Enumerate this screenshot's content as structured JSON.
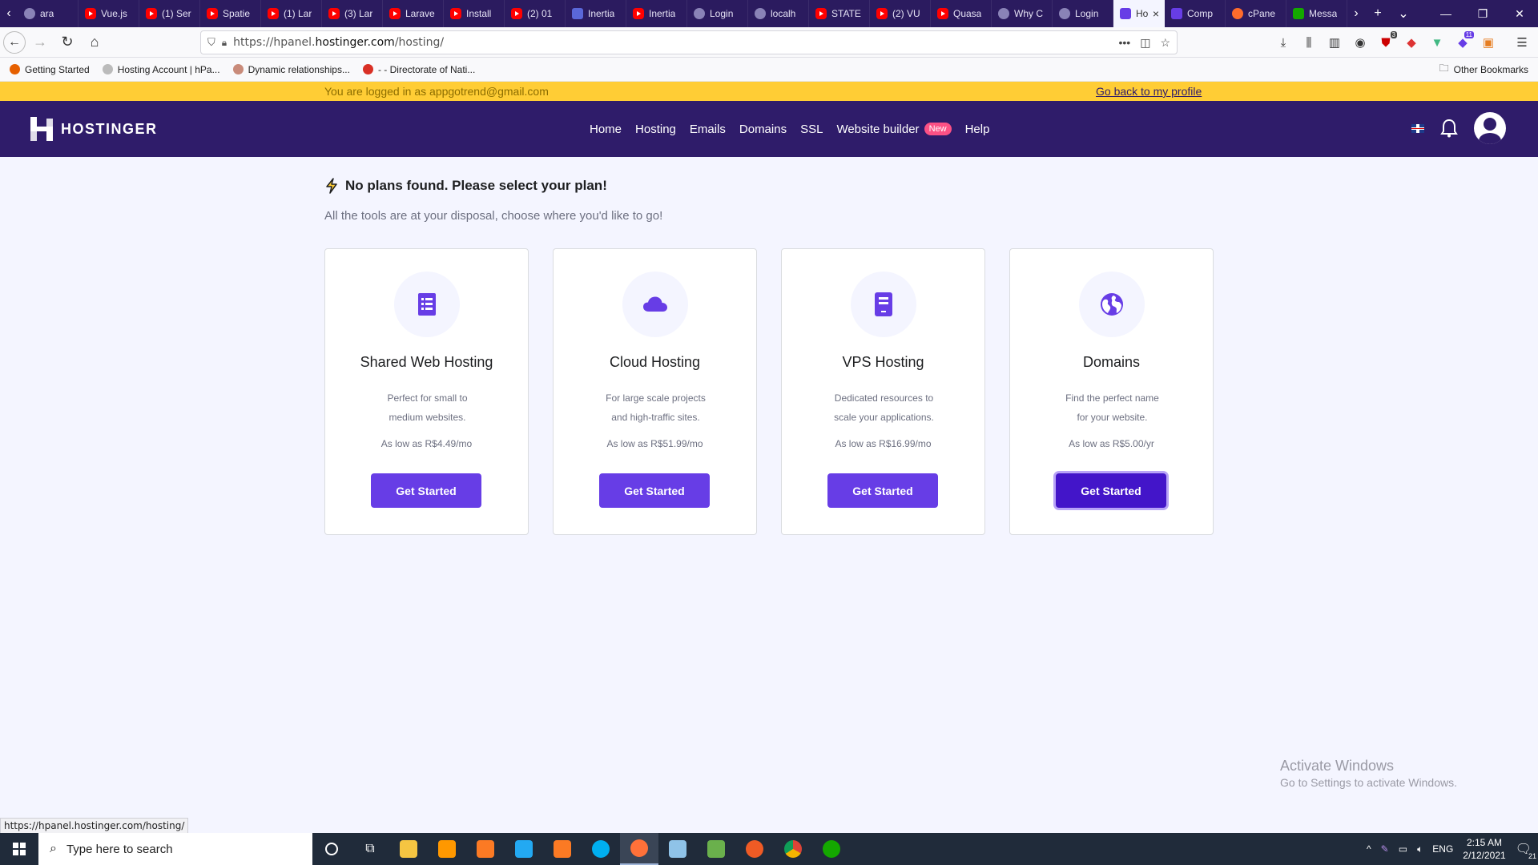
{
  "browser": {
    "tabs": [
      {
        "label": "ara",
        "fav": "gen"
      },
      {
        "label": "Vue.js",
        "fav": "yt"
      },
      {
        "label": "(1) Ser",
        "fav": "yt"
      },
      {
        "label": "Spatie",
        "fav": "yt"
      },
      {
        "label": "(1) Lar",
        "fav": "yt"
      },
      {
        "label": "(3) Lar",
        "fav": "yt"
      },
      {
        "label": "Larave",
        "fav": "yt"
      },
      {
        "label": "Install",
        "fav": "yt"
      },
      {
        "label": "(2) 01",
        "fav": "yt"
      },
      {
        "label": "Inertia",
        "fav": "ine"
      },
      {
        "label": "Inertia",
        "fav": "yt"
      },
      {
        "label": "Login",
        "fav": "gen"
      },
      {
        "label": "localh",
        "fav": "gen"
      },
      {
        "label": "STATE",
        "fav": "yt"
      },
      {
        "label": "(2) VU",
        "fav": "yt"
      },
      {
        "label": "Quasa",
        "fav": "yt"
      },
      {
        "label": "Why C",
        "fav": "gen"
      },
      {
        "label": "Login",
        "fav": "gen"
      },
      {
        "label": "Ho",
        "fav": "h",
        "active": true
      },
      {
        "label": "Comp",
        "fav": "h"
      },
      {
        "label": "cPane",
        "fav": "cp"
      },
      {
        "label": "Messa",
        "fav": "up"
      }
    ],
    "url_prefix": "https://hpanel.",
    "url_domain": "hostinger.com",
    "url_path": "/hosting/",
    "bookmarks": [
      {
        "label": "Getting Started",
        "color": "#e66000"
      },
      {
        "label": "Hosting Account | hPa...",
        "color": "#bbbbbb"
      },
      {
        "label": "Dynamic relationships...",
        "color": "#c98b7a"
      },
      {
        "label": "- - Directorate of Nati...",
        "color": "#d93025"
      }
    ],
    "other_bookmarks": "Other Bookmarks",
    "status_url": "https://hpanel.hostinger.com/hosting/",
    "badge_counts": {
      "ublock": "3",
      "ext": "11"
    }
  },
  "impersonation": {
    "text": "You are logged in as appgotrend@gmail.com",
    "link": "Go back to my profile"
  },
  "header": {
    "logo": "HOSTINGER",
    "nav": [
      "Home",
      "Hosting",
      "Emails",
      "Domains",
      "SSL",
      "Website builder",
      "Help"
    ],
    "new_badge": "New"
  },
  "main": {
    "heading": "No plans found. Please select your plan!",
    "subheading": "All the tools are at your disposal, choose where you'd like to go!",
    "cards": [
      {
        "title": "Shared Web Hosting",
        "desc1": "Perfect for small to",
        "desc2": "medium websites.",
        "price": "As low as R$4.49/mo",
        "button": "Get Started",
        "icon": "list-icon"
      },
      {
        "title": "Cloud Hosting",
        "desc1": "For large scale projects",
        "desc2": "and high-traffic sites.",
        "price": "As low as R$51.99/mo",
        "button": "Get Started",
        "icon": "cloud-icon"
      },
      {
        "title": "VPS Hosting",
        "desc1": "Dedicated resources to",
        "desc2": "scale your applications.",
        "price": "As low as R$16.99/mo",
        "button": "Get Started",
        "icon": "server-icon"
      },
      {
        "title": "Domains",
        "desc1": "Find the perfect name",
        "desc2": "for your website.",
        "price": "As low as R$5.00/yr",
        "button": "Get Started",
        "icon": "globe-icon"
      }
    ]
  },
  "watermark": {
    "line1": "Activate Windows",
    "line2": "Go to Settings to activate Windows."
  },
  "taskbar": {
    "search_placeholder": "Type here to search",
    "lang": "ENG",
    "time": "2:15 AM",
    "date": "2/12/2021",
    "notif_count": "21"
  },
  "colors": {
    "brand": "#673de6",
    "header_bg": "#2f1c6a",
    "banner": "#ffcd35"
  }
}
